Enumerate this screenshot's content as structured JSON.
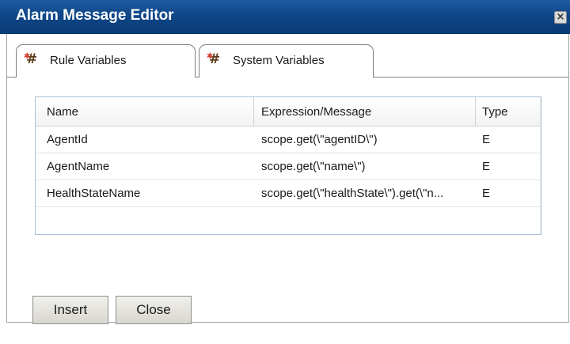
{
  "window": {
    "title": "Alarm Message Editor",
    "close_icon": "close-x-icon"
  },
  "tabs": [
    {
      "label": "Rule Variables",
      "icon": "variables-hash-icon",
      "selected": true
    },
    {
      "label": "System Variables",
      "icon": "variables-hash-icon",
      "selected": false
    }
  ],
  "table": {
    "columns": [
      "Name",
      "Expression/Message",
      "Type"
    ],
    "rows": [
      {
        "name": "AgentId",
        "expression": "scope.get(\\\"agentID\\\")",
        "type": "E"
      },
      {
        "name": "AgentName",
        "expression": "scope.get(\\\"name\\\")",
        "type": "E"
      },
      {
        "name": "HealthStateName",
        "expression": "scope.get(\\\"healthState\\\").get(\\\"n...",
        "type": "E"
      }
    ]
  },
  "buttons": {
    "insert": "Insert",
    "close": "Close"
  },
  "colors": {
    "titlebar": "#0f4788",
    "grid_border": "#a9bfd6"
  }
}
